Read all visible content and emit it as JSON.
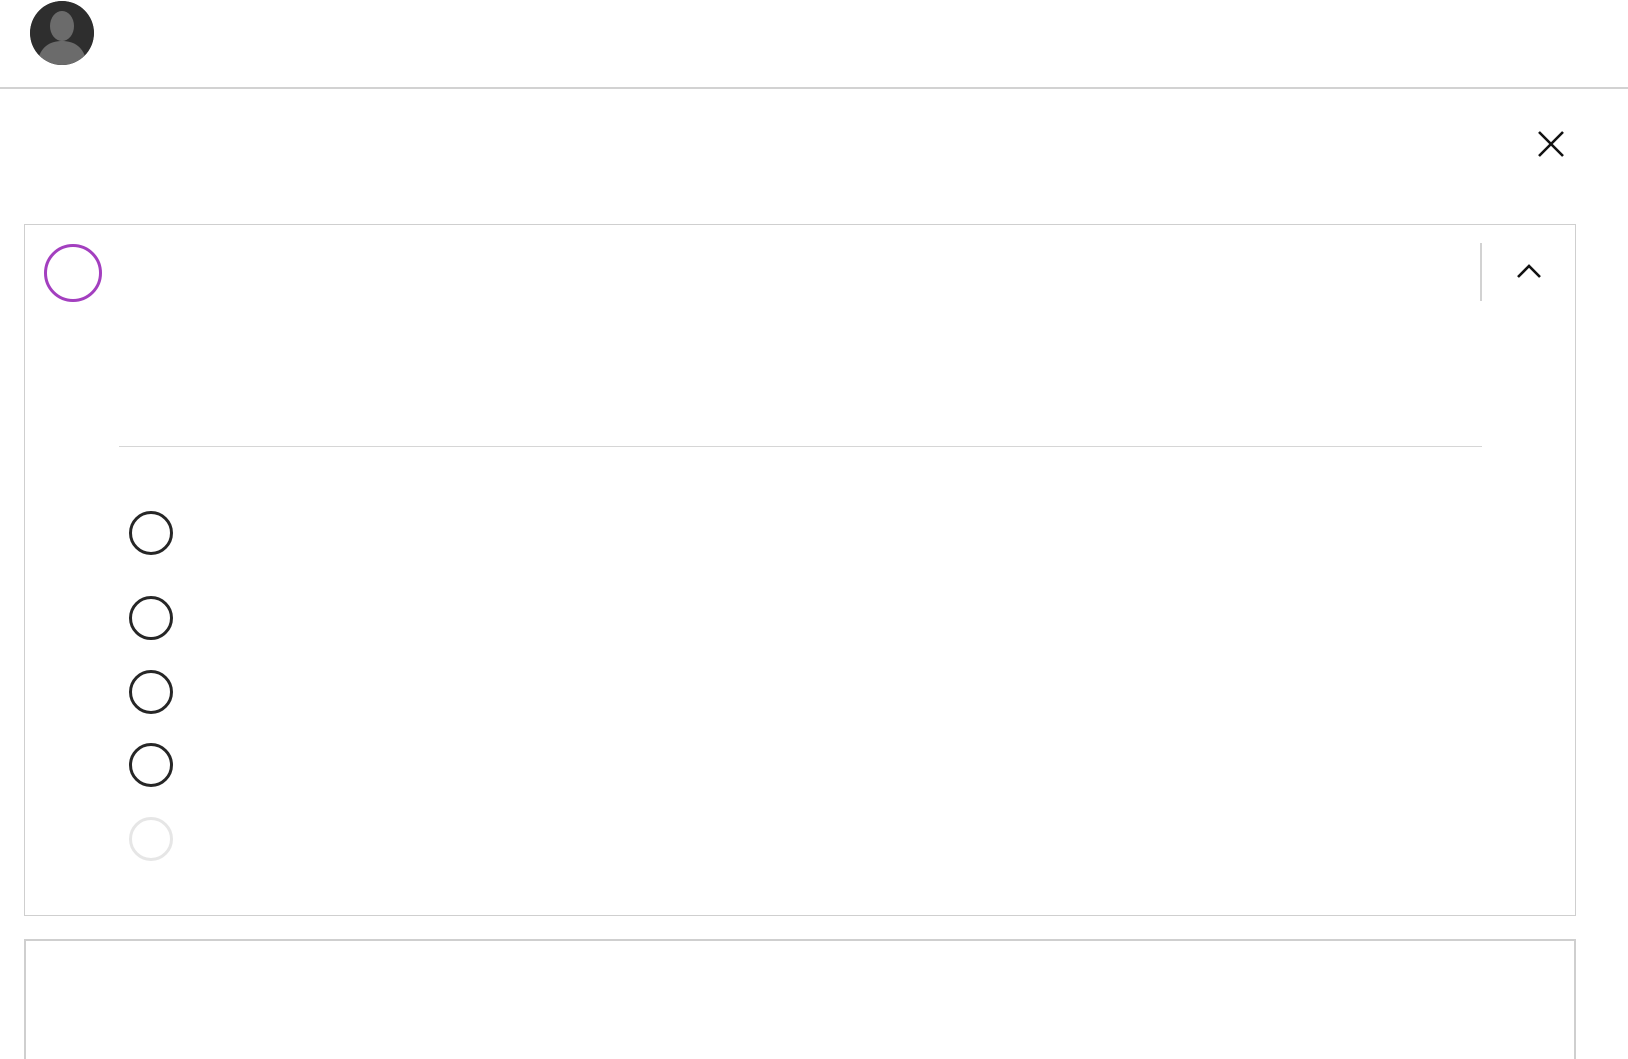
{
  "header": {
    "avatar_icon": "user-silhouette-icon"
  },
  "close_icon": "close-icon",
  "question": {
    "status_color": "#a33fbf",
    "title": "",
    "text": "",
    "collapse_icon": "chevron-up-icon",
    "answers": [
      {
        "label": "",
        "enabled": true
      },
      {
        "label": "",
        "enabled": true
      },
      {
        "label": "",
        "enabled": true
      },
      {
        "label": "",
        "enabled": true
      },
      {
        "label": "",
        "enabled": false
      }
    ]
  },
  "next_question": {
    "title": ""
  }
}
